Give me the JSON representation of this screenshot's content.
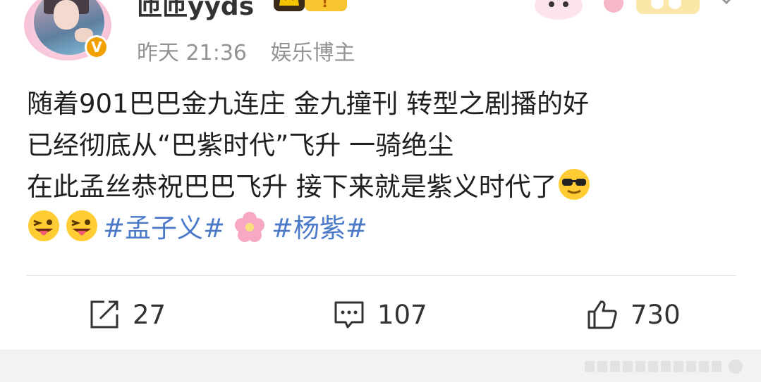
{
  "header": {
    "username": "匝匝yyds",
    "verified_badge": "V",
    "time": "昨天 21:36",
    "category": "娱乐博主"
  },
  "post": {
    "lines": [
      "随着901巴巴金九连庄 金九撞刊 转型之剧播的好",
      "已经彻底从“巴紫时代”飞升 一骑绝尘",
      "在此孟丝恭祝巴巴飞升 接下来就是紫义时代了"
    ],
    "hashtags": [
      "#孟子义#",
      "#杨紫#"
    ],
    "emojis": [
      "sunglasses-face",
      "winking-tongue-face",
      "winking-tongue-face",
      "cherry-blossom"
    ]
  },
  "actions": {
    "repost_count": "27",
    "comment_count": "107",
    "like_count": "730"
  },
  "colors": {
    "hashtag": "#4a7ac8",
    "badge": "#f2a000",
    "meta": "#939393"
  }
}
